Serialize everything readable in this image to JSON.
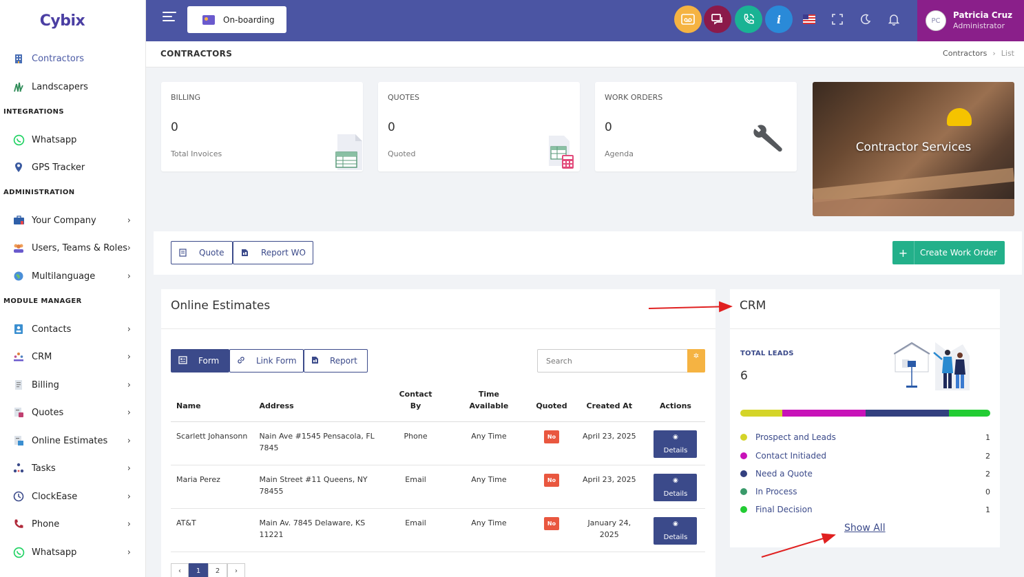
{
  "app": {
    "logo": "Cybix"
  },
  "sidebar": {
    "items_top": [
      {
        "label": "Contractors",
        "icon": "building-icon",
        "active": true
      },
      {
        "label": "Landscapers",
        "icon": "grass-icon"
      }
    ],
    "sections": [
      {
        "title": "INTEGRATIONS",
        "items": [
          {
            "label": "Whatsapp",
            "icon": "whatsapp-icon"
          },
          {
            "label": "GPS Tracker",
            "icon": "map-pin-icon"
          }
        ]
      },
      {
        "title": "ADMINISTRATION",
        "items": [
          {
            "label": "Your Company",
            "icon": "briefcase-icon"
          },
          {
            "label": "Users, Teams & Roles",
            "icon": "users-icon"
          },
          {
            "label": "Multilanguage",
            "icon": "globe-icon"
          }
        ]
      },
      {
        "title": "MODULE MANAGER",
        "items": [
          {
            "label": "Contacts",
            "icon": "contacts-icon"
          },
          {
            "label": "CRM",
            "icon": "crm-icon"
          },
          {
            "label": "Billing",
            "icon": "billing-icon"
          },
          {
            "label": "Quotes",
            "icon": "quotes-icon"
          },
          {
            "label": "Online Estimates",
            "icon": "estimates-icon"
          },
          {
            "label": "Tasks",
            "icon": "tasks-icon"
          },
          {
            "label": "ClockEase",
            "icon": "clock-icon"
          },
          {
            "label": "Phone",
            "icon": "phone-icon"
          },
          {
            "label": "Whatsapp",
            "icon": "whatsapp-icon"
          }
        ]
      }
    ]
  },
  "topbar": {
    "onboarding_label": "On-boarding",
    "user_initials": "PC",
    "user_name": "Patricia Cruz",
    "user_role": "Administrator",
    "colors": {
      "bar": "#4b55a3",
      "user_box": "#8a1f8a"
    }
  },
  "breadcrumb": {
    "page_title": "CONTRACTORS",
    "path": [
      "Contractors",
      "List"
    ]
  },
  "stats": {
    "billing": {
      "label": "BILLING",
      "value": "0",
      "sub": "Total Invoices"
    },
    "quotes": {
      "label": "QUOTES",
      "value": "0",
      "sub": "Quoted"
    },
    "work_orders": {
      "label": "WORK ORDERS",
      "value": "0",
      "sub": "Agenda"
    }
  },
  "hero": {
    "text": "Contractor Services"
  },
  "actions": {
    "quote_label": "Quote",
    "report_wo_label": "Report WO",
    "create_wo_label": "Create Work Order"
  },
  "estimates": {
    "title": "Online Estimates",
    "tabs": {
      "form": "Form",
      "link_form": "Link Form",
      "report": "Report"
    },
    "search_placeholder": "Search",
    "columns": {
      "name": "Name",
      "address": "Address",
      "contact_by": "Contact By",
      "time_available": "Time Available",
      "quoted": "Quoted",
      "created_at": "Created At",
      "actions": "Actions"
    },
    "rows": [
      {
        "name": "Scarlett Johansonn",
        "address": "Nain Ave #1545 Pensacola, FL 7845",
        "contact_by": "Phone",
        "time_available": "Any Time",
        "quoted": "No",
        "created_at": "April 23, 2025",
        "action": "Details"
      },
      {
        "name": "Maria Perez",
        "address": "Main Street #11 Queens, NY 78455",
        "contact_by": "Email",
        "time_available": "Any Time",
        "quoted": "No",
        "created_at": "April 23, 2025",
        "action": "Details"
      },
      {
        "name": "AT&T",
        "address": "Main Av. 7845 Delaware, KS 11221",
        "contact_by": "Email",
        "time_available": "Any Time",
        "quoted": "No",
        "created_at": "January 24, 2025",
        "action": "Details"
      }
    ],
    "pagination": {
      "prev": "‹",
      "pages": [
        "1",
        "2"
      ],
      "next": "›",
      "current": "1"
    }
  },
  "crm": {
    "title": "CRM",
    "total_leads_label": "TOTAL LEADS",
    "total_leads_value": "6",
    "stages": [
      {
        "label": "Prospect and Leads",
        "count": "1",
        "color": "#d4d429"
      },
      {
        "label": "Contact Initiaded",
        "count": "2",
        "color": "#c812b8"
      },
      {
        "label": "Need a Quote",
        "count": "2",
        "color": "#33407f"
      },
      {
        "label": "In Process",
        "count": "0",
        "color": "#3a9a6a"
      },
      {
        "label": "Final Decision",
        "count": "1",
        "color": "#22cc33"
      }
    ],
    "show_all_label": "Show All"
  }
}
